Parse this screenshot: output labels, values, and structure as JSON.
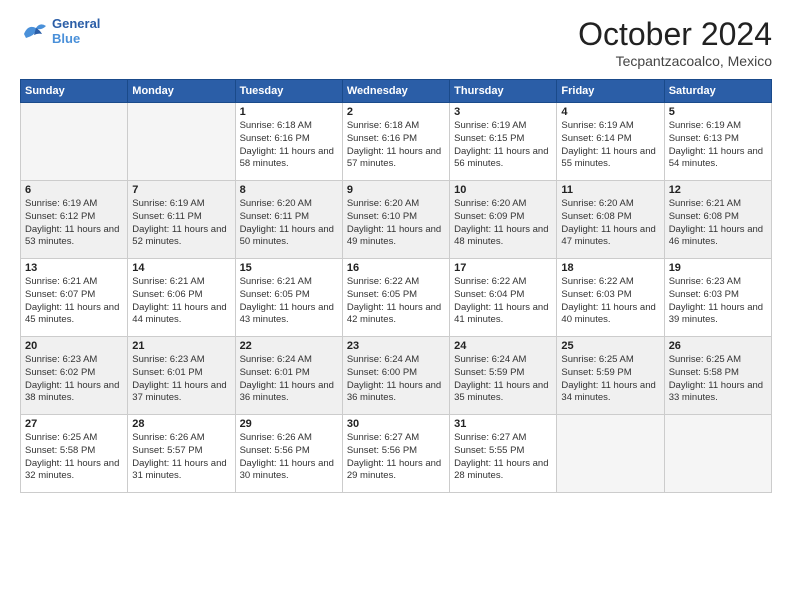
{
  "logo": {
    "line1": "General",
    "line2": "Blue"
  },
  "title": "October 2024",
  "location": "Tecpantzacoalco, Mexico",
  "headers": [
    "Sunday",
    "Monday",
    "Tuesday",
    "Wednesday",
    "Thursday",
    "Friday",
    "Saturday"
  ],
  "weeks": [
    [
      {
        "day": "",
        "info": ""
      },
      {
        "day": "",
        "info": ""
      },
      {
        "day": "1",
        "info": "Sunrise: 6:18 AM\nSunset: 6:16 PM\nDaylight: 11 hours and 58 minutes."
      },
      {
        "day": "2",
        "info": "Sunrise: 6:18 AM\nSunset: 6:16 PM\nDaylight: 11 hours and 57 minutes."
      },
      {
        "day": "3",
        "info": "Sunrise: 6:19 AM\nSunset: 6:15 PM\nDaylight: 11 hours and 56 minutes."
      },
      {
        "day": "4",
        "info": "Sunrise: 6:19 AM\nSunset: 6:14 PM\nDaylight: 11 hours and 55 minutes."
      },
      {
        "day": "5",
        "info": "Sunrise: 6:19 AM\nSunset: 6:13 PM\nDaylight: 11 hours and 54 minutes."
      }
    ],
    [
      {
        "day": "6",
        "info": "Sunrise: 6:19 AM\nSunset: 6:12 PM\nDaylight: 11 hours and 53 minutes."
      },
      {
        "day": "7",
        "info": "Sunrise: 6:19 AM\nSunset: 6:11 PM\nDaylight: 11 hours and 52 minutes."
      },
      {
        "day": "8",
        "info": "Sunrise: 6:20 AM\nSunset: 6:11 PM\nDaylight: 11 hours and 50 minutes."
      },
      {
        "day": "9",
        "info": "Sunrise: 6:20 AM\nSunset: 6:10 PM\nDaylight: 11 hours and 49 minutes."
      },
      {
        "day": "10",
        "info": "Sunrise: 6:20 AM\nSunset: 6:09 PM\nDaylight: 11 hours and 48 minutes."
      },
      {
        "day": "11",
        "info": "Sunrise: 6:20 AM\nSunset: 6:08 PM\nDaylight: 11 hours and 47 minutes."
      },
      {
        "day": "12",
        "info": "Sunrise: 6:21 AM\nSunset: 6:08 PM\nDaylight: 11 hours and 46 minutes."
      }
    ],
    [
      {
        "day": "13",
        "info": "Sunrise: 6:21 AM\nSunset: 6:07 PM\nDaylight: 11 hours and 45 minutes."
      },
      {
        "day": "14",
        "info": "Sunrise: 6:21 AM\nSunset: 6:06 PM\nDaylight: 11 hours and 44 minutes."
      },
      {
        "day": "15",
        "info": "Sunrise: 6:21 AM\nSunset: 6:05 PM\nDaylight: 11 hours and 43 minutes."
      },
      {
        "day": "16",
        "info": "Sunrise: 6:22 AM\nSunset: 6:05 PM\nDaylight: 11 hours and 42 minutes."
      },
      {
        "day": "17",
        "info": "Sunrise: 6:22 AM\nSunset: 6:04 PM\nDaylight: 11 hours and 41 minutes."
      },
      {
        "day": "18",
        "info": "Sunrise: 6:22 AM\nSunset: 6:03 PM\nDaylight: 11 hours and 40 minutes."
      },
      {
        "day": "19",
        "info": "Sunrise: 6:23 AM\nSunset: 6:03 PM\nDaylight: 11 hours and 39 minutes."
      }
    ],
    [
      {
        "day": "20",
        "info": "Sunrise: 6:23 AM\nSunset: 6:02 PM\nDaylight: 11 hours and 38 minutes."
      },
      {
        "day": "21",
        "info": "Sunrise: 6:23 AM\nSunset: 6:01 PM\nDaylight: 11 hours and 37 minutes."
      },
      {
        "day": "22",
        "info": "Sunrise: 6:24 AM\nSunset: 6:01 PM\nDaylight: 11 hours and 36 minutes."
      },
      {
        "day": "23",
        "info": "Sunrise: 6:24 AM\nSunset: 6:00 PM\nDaylight: 11 hours and 36 minutes."
      },
      {
        "day": "24",
        "info": "Sunrise: 6:24 AM\nSunset: 5:59 PM\nDaylight: 11 hours and 35 minutes."
      },
      {
        "day": "25",
        "info": "Sunrise: 6:25 AM\nSunset: 5:59 PM\nDaylight: 11 hours and 34 minutes."
      },
      {
        "day": "26",
        "info": "Sunrise: 6:25 AM\nSunset: 5:58 PM\nDaylight: 11 hours and 33 minutes."
      }
    ],
    [
      {
        "day": "27",
        "info": "Sunrise: 6:25 AM\nSunset: 5:58 PM\nDaylight: 11 hours and 32 minutes."
      },
      {
        "day": "28",
        "info": "Sunrise: 6:26 AM\nSunset: 5:57 PM\nDaylight: 11 hours and 31 minutes."
      },
      {
        "day": "29",
        "info": "Sunrise: 6:26 AM\nSunset: 5:56 PM\nDaylight: 11 hours and 30 minutes."
      },
      {
        "day": "30",
        "info": "Sunrise: 6:27 AM\nSunset: 5:56 PM\nDaylight: 11 hours and 29 minutes."
      },
      {
        "day": "31",
        "info": "Sunrise: 6:27 AM\nSunset: 5:55 PM\nDaylight: 11 hours and 28 minutes."
      },
      {
        "day": "",
        "info": ""
      },
      {
        "day": "",
        "info": ""
      }
    ]
  ]
}
